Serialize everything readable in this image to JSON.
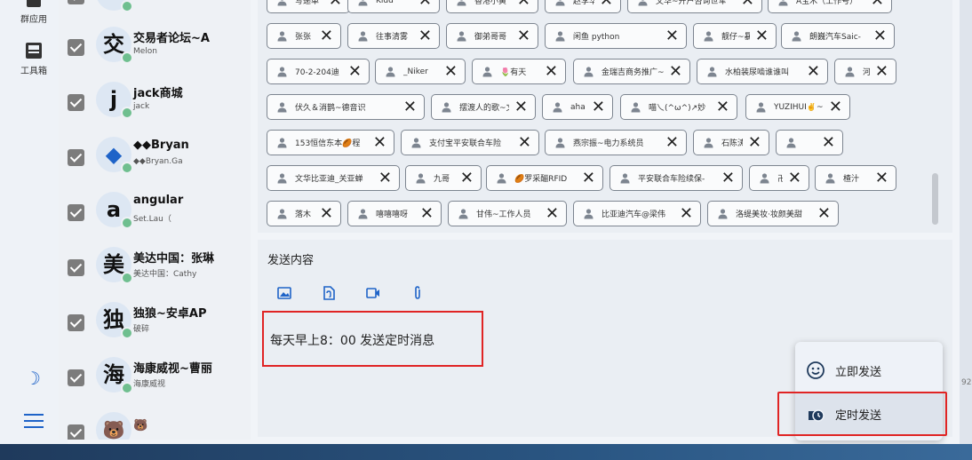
{
  "rail": {
    "items": [
      {
        "label": "群应用"
      },
      {
        "label": "工具箱"
      }
    ]
  },
  "contacts": [
    {
      "avatar": "",
      "name": "",
      "sub": "",
      "partial": true
    },
    {
      "avatar": "交",
      "name": "交易者论坛~A",
      "sub": "Melon"
    },
    {
      "avatar": "j",
      "name": "jack商城",
      "sub": "jack"
    },
    {
      "avatar": "◆",
      "name": "◆◆Bryan",
      "sub": "◆◆Bryan.Ga"
    },
    {
      "avatar": "a",
      "name": "angular",
      "sub": "Set.Lau（"
    },
    {
      "avatar": "美",
      "name": "美达中国：张琳",
      "sub": "美达中国：Cathy"
    },
    {
      "avatar": "独",
      "name": "独狼~安卓AP",
      "sub": "破碎"
    },
    {
      "avatar": "海",
      "name": "海康威视~曹丽",
      "sub": "海康威视"
    },
    {
      "avatar": "🐻",
      "name": "🐻",
      "sub": ""
    }
  ],
  "tag_rows": [
    [
      "写递单",
      "Kidd",
      "香港小黄",
      "赵李华",
      "文华~开户咨询世军",
      "A宝木（工作号）"
    ],
    [
      "张张",
      "往事清雾",
      "御弟哥哥",
      "闲鱼 python",
      "靓仔~暴鸡电竞",
      "朗巍汽车Saic-"
    ],
    [
      "70-2-204迪",
      "_Niker",
      "🌷有天",
      "金瑞吉商务推广~丙",
      "水柏装尿啮谁谁叫",
      "河图"
    ],
    [
      "伏久＆消鹊~德音识",
      "摆渡人的歌~文山",
      "aha",
      "喵乀(^ω^)↗妙",
      "YUZIHUI✌️~"
    ],
    [
      "153恒信东本🏉程",
      "支付宝平安联合车险",
      "燕宗振~电力系统员",
      "石陈涛",
      ""
    ],
    [
      "文华比亚迪_关亚蝉",
      "九哥",
      "🏉罗采酾RFID",
      "平安联合车险续保-",
      "卍",
      "楂汁"
    ],
    [
      "落木",
      "嘻嘻嘻呀",
      "甘伟~工作人员",
      "比亚迪汽车@梁伟",
      "洛缇美妆·妆颜美甜"
    ]
  ],
  "composer": {
    "title": "发送内容",
    "message": "每天早上8：00 发送定时消息",
    "tools": [
      "image-icon",
      "file-icon",
      "video-icon",
      "attachment-icon"
    ]
  },
  "send_menu": {
    "items": [
      {
        "label": "立即发送",
        "icon": "smile-icon"
      },
      {
        "label": "定时发送",
        "icon": "clock-icon"
      }
    ]
  },
  "edge_number": "92",
  "colors": {
    "accent": "#1e63c8",
    "highlight": "#e02424"
  }
}
